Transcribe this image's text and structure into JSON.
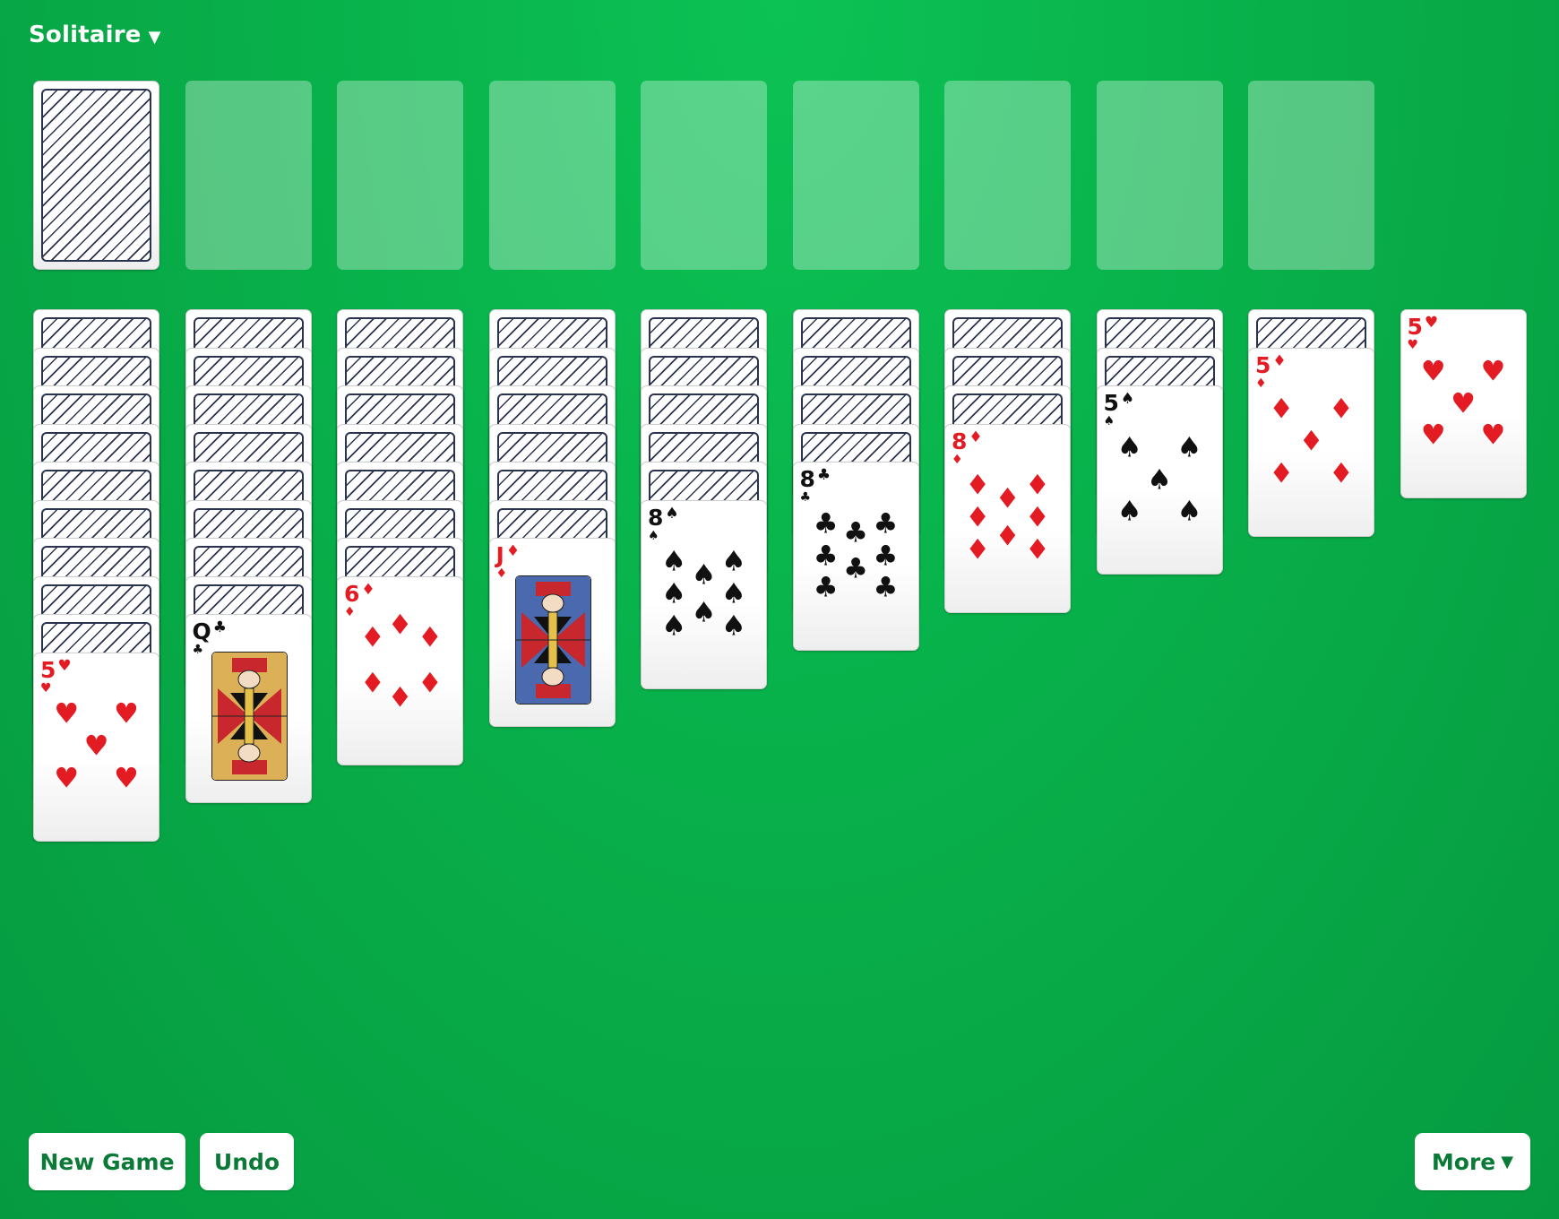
{
  "header": {
    "title": "Solitaire",
    "caret": "▼"
  },
  "buttons": {
    "new_game": "New Game",
    "undo": "Undo",
    "more": "More",
    "more_caret": "▼"
  },
  "stock": {
    "face_down": true
  },
  "foundations_empty_count": 8,
  "colors": {
    "felt": "#08b04a",
    "red_suit": "#e31b23",
    "black_suit": "#111111",
    "button_text": "#0a7a36"
  },
  "tableau": [
    {
      "face_down": 9,
      "top": {
        "rank": "5",
        "suit": "♥",
        "color": "red"
      }
    },
    {
      "face_down": 8,
      "top": {
        "rank": "Q",
        "suit": "♣",
        "color": "black",
        "face": "queen"
      }
    },
    {
      "face_down": 7,
      "top": {
        "rank": "6",
        "suit": "♦",
        "color": "red"
      }
    },
    {
      "face_down": 6,
      "top": {
        "rank": "J",
        "suit": "♦",
        "color": "red",
        "face": "jack"
      }
    },
    {
      "face_down": 5,
      "top": {
        "rank": "8",
        "suit": "♠",
        "color": "black"
      }
    },
    {
      "face_down": 4,
      "top": {
        "rank": "8",
        "suit": "♣",
        "color": "black"
      }
    },
    {
      "face_down": 3,
      "top": {
        "rank": "8",
        "suit": "♦",
        "color": "red"
      }
    },
    {
      "face_down": 2,
      "top": {
        "rank": "5",
        "suit": "♠",
        "color": "black"
      }
    },
    {
      "face_down": 1,
      "top": {
        "rank": "5",
        "suit": "♦",
        "color": "red"
      }
    },
    {
      "face_down": 0,
      "top": {
        "rank": "5",
        "suit": "♥",
        "color": "red"
      }
    }
  ]
}
